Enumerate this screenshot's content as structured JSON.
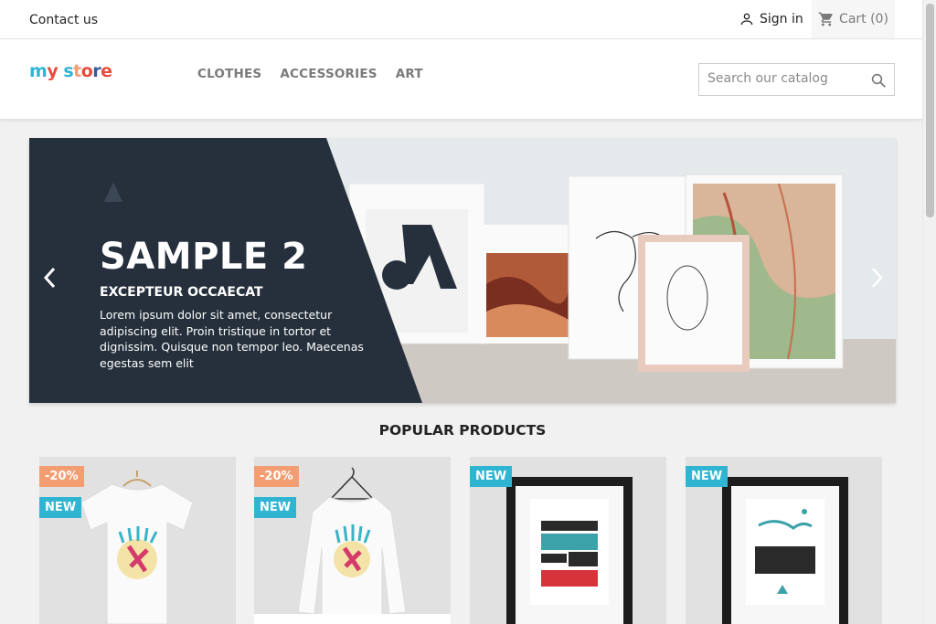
{
  "topbar": {
    "contact": "Contact us",
    "signin": "Sign in",
    "cart": "Cart (0)"
  },
  "header": {
    "logo": "my store",
    "menu": [
      "CLOTHES",
      "ACCESSORIES",
      "ART"
    ],
    "search_placeholder": "Search our catalog"
  },
  "carousel": {
    "title": "SAMPLE 2",
    "subtitle": "EXCEPTEUR OCCAECAT",
    "text": "Lorem ipsum dolor sit amet, consectetur adipiscing elit. Proin tristique in tortor et dignissim. Quisque non tempor leo. Maecenas egestas sem elit"
  },
  "section": {
    "title": "POPULAR PRODUCTS"
  },
  "products": [
    {
      "discount": "-20%",
      "flag": "NEW",
      "kind": "tshirt"
    },
    {
      "discount": "-20%",
      "flag": "NEW",
      "kind": "sweater"
    },
    {
      "discount": "",
      "flag": "NEW",
      "kind": "poster-best"
    },
    {
      "discount": "",
      "flag": "NEW",
      "kind": "poster-adventure"
    }
  ],
  "colors": {
    "accent": "#2fb5d2",
    "discount": "#f39d72",
    "slide_panel": "#25303c"
  }
}
